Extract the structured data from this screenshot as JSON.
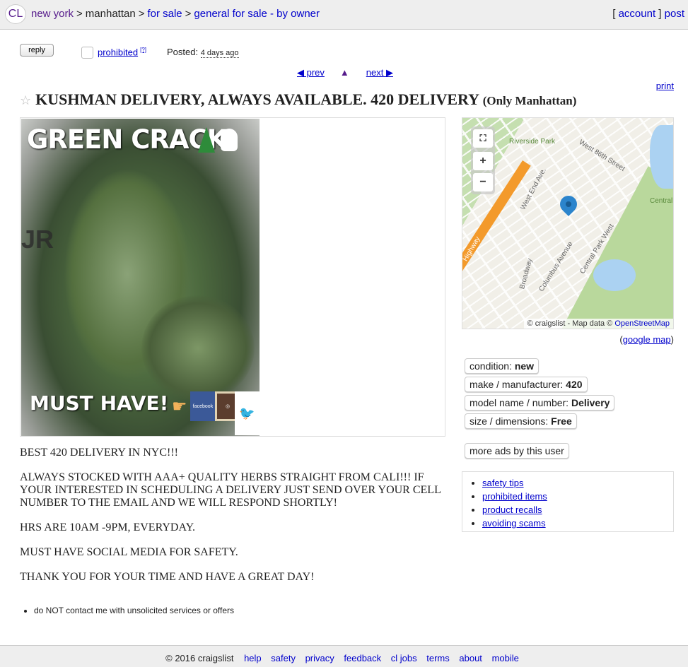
{
  "header": {
    "logo": "CL",
    "crumbs": [
      "new york",
      "manhattan",
      "for sale",
      "general for sale - by owner"
    ],
    "account": "account",
    "post": "post"
  },
  "actions": {
    "reply": "reply",
    "prohibited": "prohibited",
    "prohibited_help": "[?]",
    "posted_label": "Posted:",
    "posted_value": "4 days ago"
  },
  "nav": {
    "prev": "◀ prev",
    "up": "▲",
    "next": "next ▶"
  },
  "print": "print",
  "title": {
    "main": "KUSHMAN DELIVERY, ALWAYS AVAILABLE. 420 DELIVERY",
    "location": "(Only Manhattan)"
  },
  "image": {
    "top_text": "GREEN CRACK",
    "bottom_text": "MUST HAVE!",
    "bg_text": "JR",
    "fb": "facebook"
  },
  "body": [
    "BEST 420 DELIVERY IN NYC!!!",
    "ALWAYS STOCKED WITH AAA+ QUALITY HERBS STRAIGHT FROM CALI!!! IF YOUR INTERESTED IN SCHEDULING A DELIVERY JUST SEND OVER YOUR CELL NUMBER TO THE EMAIL AND WE WILL RESPOND SHORTLY!",
    "HRS ARE 10AM -9PM, EVERYDAY.",
    "MUST HAVE SOCIAL MEDIA FOR SAFETY.",
    "THANK YOU FOR YOUR TIME AND HAVE A GREAT DAY!"
  ],
  "notice": "do NOT contact me with unsolicited services or offers",
  "map": {
    "labels": {
      "riverside": "Riverside Park",
      "w86": "West 86th Street",
      "westend": "West End Ave.",
      "central": "Central Park",
      "cpw": "Central Park West",
      "columbus": "Columbus Avenue",
      "broadway": "Broadway",
      "highway": "Highway"
    },
    "attribution_prefix": "© craigslist - Map data ©",
    "attribution_link": "OpenStreetMap",
    "google": "google map"
  },
  "attributes": [
    {
      "label": "condition:",
      "value": "new"
    },
    {
      "label": "make / manufacturer:",
      "value": "420"
    },
    {
      "label": "model name / number:",
      "value": "Delivery"
    },
    {
      "label": "size / dimensions:",
      "value": "Free"
    }
  ],
  "more_ads": "more ads by this user",
  "safety": [
    "safety tips",
    "prohibited items",
    "product recalls",
    "avoiding scams"
  ],
  "footer": {
    "copyright": "© 2016 craigslist",
    "links": [
      "help",
      "safety",
      "privacy",
      "feedback",
      "cl jobs",
      "terms",
      "about",
      "mobile"
    ]
  }
}
